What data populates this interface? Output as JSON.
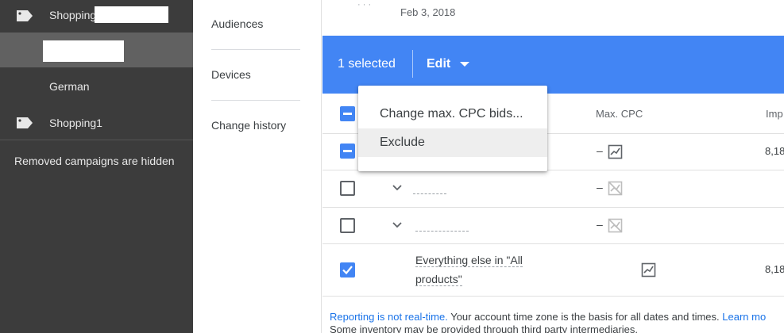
{
  "sidebar": {
    "campaign_label": "Shopping",
    "ad_group_label": "German",
    "campaign2_label": "Shopping1",
    "removed_note": "Removed campaigns are hidden"
  },
  "midnav": {
    "items": [
      "Audiences",
      "Devices",
      "Change history"
    ]
  },
  "main": {
    "date": "Feb 3, 2018",
    "selection_count": "1 selected",
    "edit_label": "Edit",
    "columns": {
      "max_cpc": "Max. CPC",
      "impr": "Imp"
    },
    "rows": [
      {
        "max_cpc": "–",
        "impr": "8,18"
      },
      {
        "max_cpc": "–"
      },
      {
        "max_cpc": "–"
      },
      {
        "name": "Everything else in \"All products\"",
        "impr": "8,18"
      }
    ],
    "footer_link": "Reporting is not real-time.",
    "footer_text": " Your account time zone is the basis for all dates and times.",
    "footer_learn": "Learn mo",
    "footer_line2": "Some inventory may be provided through third party intermediaries."
  },
  "menu": {
    "items": [
      "Change max. CPC bids...",
      "Exclude"
    ]
  },
  "colors": {
    "sidebar_bg": "#3c3c3c",
    "accent": "#4285f4",
    "link": "#1a73e8"
  }
}
